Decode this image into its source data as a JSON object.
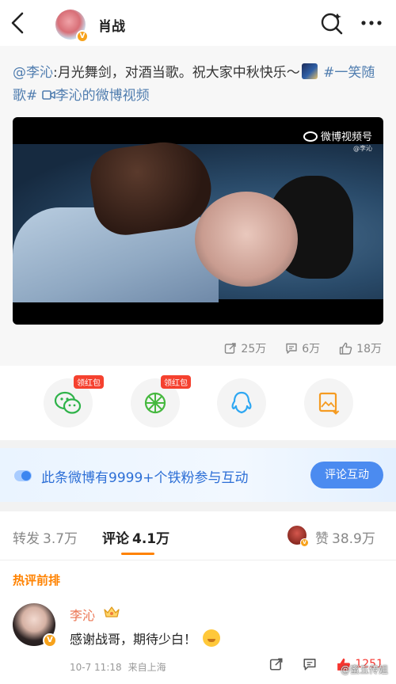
{
  "header": {
    "title": "肖战",
    "back_icon": "back-arrow-icon",
    "search_icon": "search-icon",
    "more_icon": "more-dots-icon"
  },
  "post": {
    "mention": "@李沁",
    "text_main": ":月光舞剑，对酒当歌。祝大家中秋快乐～",
    "hashtag": "#一笑随歌#",
    "video_link": "李沁的微博视频",
    "video": {
      "watermark_main": "微博视频号",
      "watermark_sub": "@李沁"
    },
    "stats": {
      "reposts": "25万",
      "comments": "6万",
      "likes": "18万"
    }
  },
  "share": {
    "items": [
      {
        "name": "wechat",
        "badge": "领红包"
      },
      {
        "name": "moments",
        "badge": "领红包"
      },
      {
        "name": "qq",
        "badge": ""
      },
      {
        "name": "save-image",
        "badge": ""
      }
    ]
  },
  "fans_banner": {
    "text": "此条微博有9999+个铁粉参与互动",
    "button": "评论互动"
  },
  "tabs": {
    "repost_label": "转发",
    "repost_count": "3.7万",
    "comment_label": "评论",
    "comment_count": "4.1万",
    "like_label": "赞",
    "like_count": "38.9万"
  },
  "comments": {
    "section_title": "热评前排",
    "items": [
      {
        "name": "李沁",
        "text": "感谢战哥，期待少白！",
        "time": "10-7 11:18",
        "location": "来自上海",
        "likes": "1251"
      }
    ]
  },
  "page_watermark": "@蜜五传姐",
  "colors": {
    "accent_orange": "#ff8200",
    "link_blue": "#507daf",
    "fans_blue": "#2d6fd6",
    "like_red": "#f6352f"
  }
}
